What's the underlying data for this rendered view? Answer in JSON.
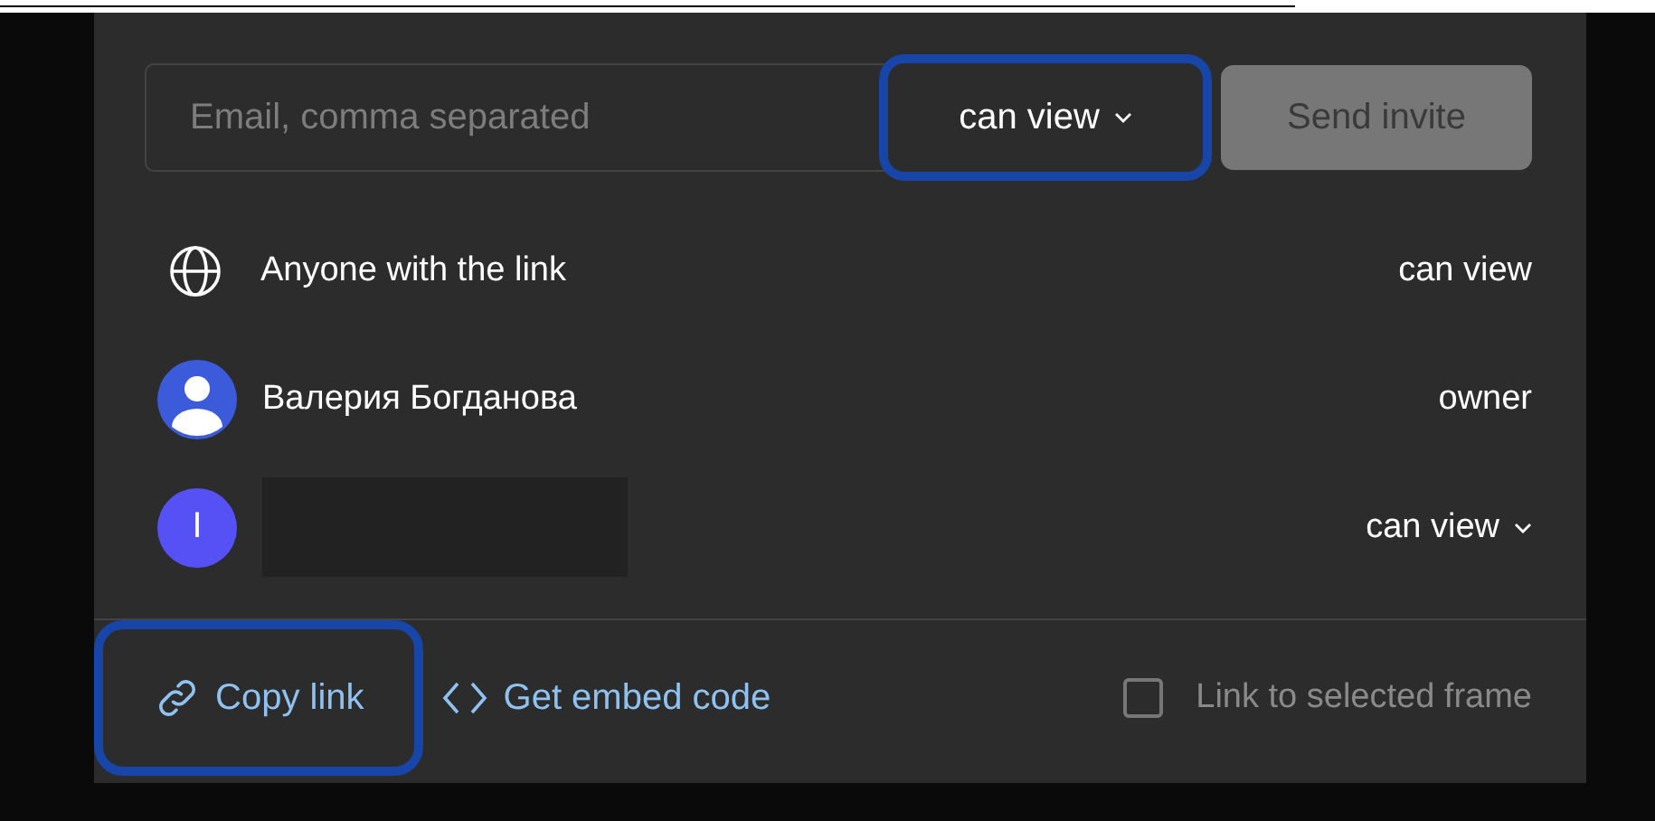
{
  "invite": {
    "placeholder": "Email, comma separated",
    "permission": {
      "label": "can view",
      "highlighted": true
    },
    "send_button": {
      "label": "Send invite",
      "disabled": true
    }
  },
  "members": [
    {
      "kind": "link",
      "name": "Anyone with the link",
      "role": "can view",
      "dropdown": false
    },
    {
      "kind": "user",
      "name": "Валерия Богданова",
      "role": "owner",
      "dropdown": false
    },
    {
      "kind": "redacted",
      "initial": "I",
      "role": "can view",
      "dropdown": true
    }
  ],
  "footer": {
    "copy_link": {
      "label": "Copy link",
      "highlighted": true
    },
    "embed": {
      "label": "Get embed code"
    },
    "frame_link": {
      "label": "Link to selected frame",
      "checked": false
    }
  }
}
